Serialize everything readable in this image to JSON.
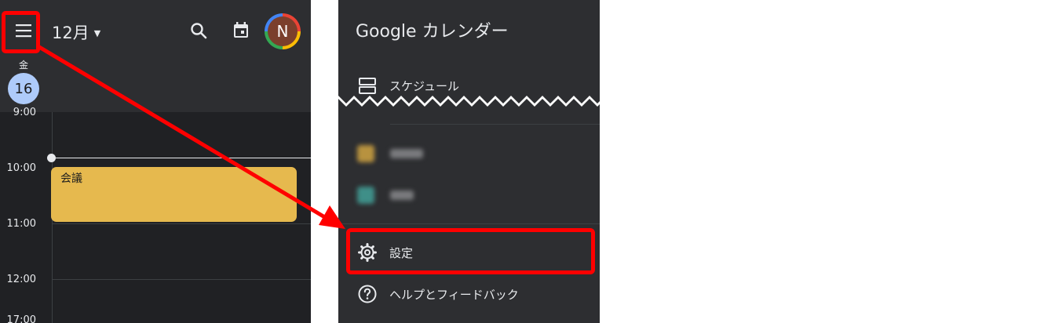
{
  "calendar": {
    "month": "12月",
    "weekday": "金",
    "date": "16",
    "avatar_initial": "N",
    "times": [
      "9:00",
      "10:00",
      "11:00",
      "12:00",
      "17:00"
    ],
    "event": {
      "title": "会議",
      "color": "#e6b94e"
    }
  },
  "drawer": {
    "title": "Google カレンダー",
    "schedule_label": "スケジュール",
    "settings_label": "設定",
    "help_label": "ヘルプとフィードバック",
    "blurred_calendars": [
      {
        "color": "#b8923f"
      },
      {
        "color": "#3f8f88"
      }
    ]
  },
  "annotations": {
    "highlight_color": "#ff0000"
  }
}
